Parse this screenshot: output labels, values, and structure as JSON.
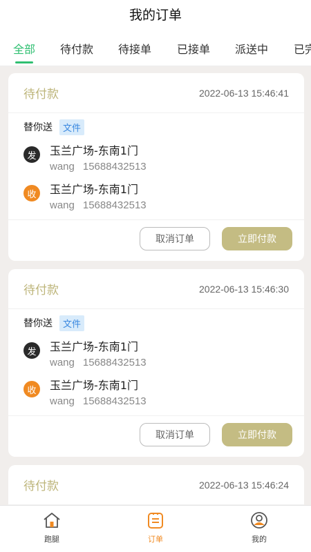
{
  "header": {
    "title": "我的订单"
  },
  "tabs": [
    {
      "label": "全部",
      "active": true
    },
    {
      "label": "待付款",
      "active": false
    },
    {
      "label": "待接单",
      "active": false
    },
    {
      "label": "已接单",
      "active": false
    },
    {
      "label": "派送中",
      "active": false
    },
    {
      "label": "已完",
      "active": false
    }
  ],
  "orders": [
    {
      "status": "待付款",
      "time": "2022-06-13 15:46:41",
      "service": "替你送",
      "tag": "文件",
      "sender": {
        "icon_label": "发",
        "address": "玉兰广场-东南1门",
        "name": "wang",
        "phone": "15688432513"
      },
      "receiver": {
        "icon_label": "收",
        "address": "玉兰广场-东南1门",
        "name": "wang",
        "phone": "15688432513"
      },
      "cancel_label": "取消订单",
      "pay_label": "立即付款"
    },
    {
      "status": "待付款",
      "time": "2022-06-13 15:46:30",
      "service": "替你送",
      "tag": "文件",
      "sender": {
        "icon_label": "发",
        "address": "玉兰广场-东南1门",
        "name": "wang",
        "phone": "15688432513"
      },
      "receiver": {
        "icon_label": "收",
        "address": "玉兰广场-东南1门",
        "name": "wang",
        "phone": "15688432513"
      },
      "cancel_label": "取消订单",
      "pay_label": "立即付款"
    },
    {
      "status": "待付款",
      "time": "2022-06-13 15:46:24"
    }
  ],
  "bottom_nav": [
    {
      "label": "跑腿",
      "icon": "house-icon",
      "active": false
    },
    {
      "label": "订单",
      "icon": "order-icon",
      "active": true
    },
    {
      "label": "我的",
      "icon": "user-icon",
      "active": false
    }
  ],
  "colors": {
    "accent_green": "#2fbf71",
    "status_gold": "#bdb57a",
    "pay_button": "#c4bc83",
    "orange": "#f08a22"
  }
}
